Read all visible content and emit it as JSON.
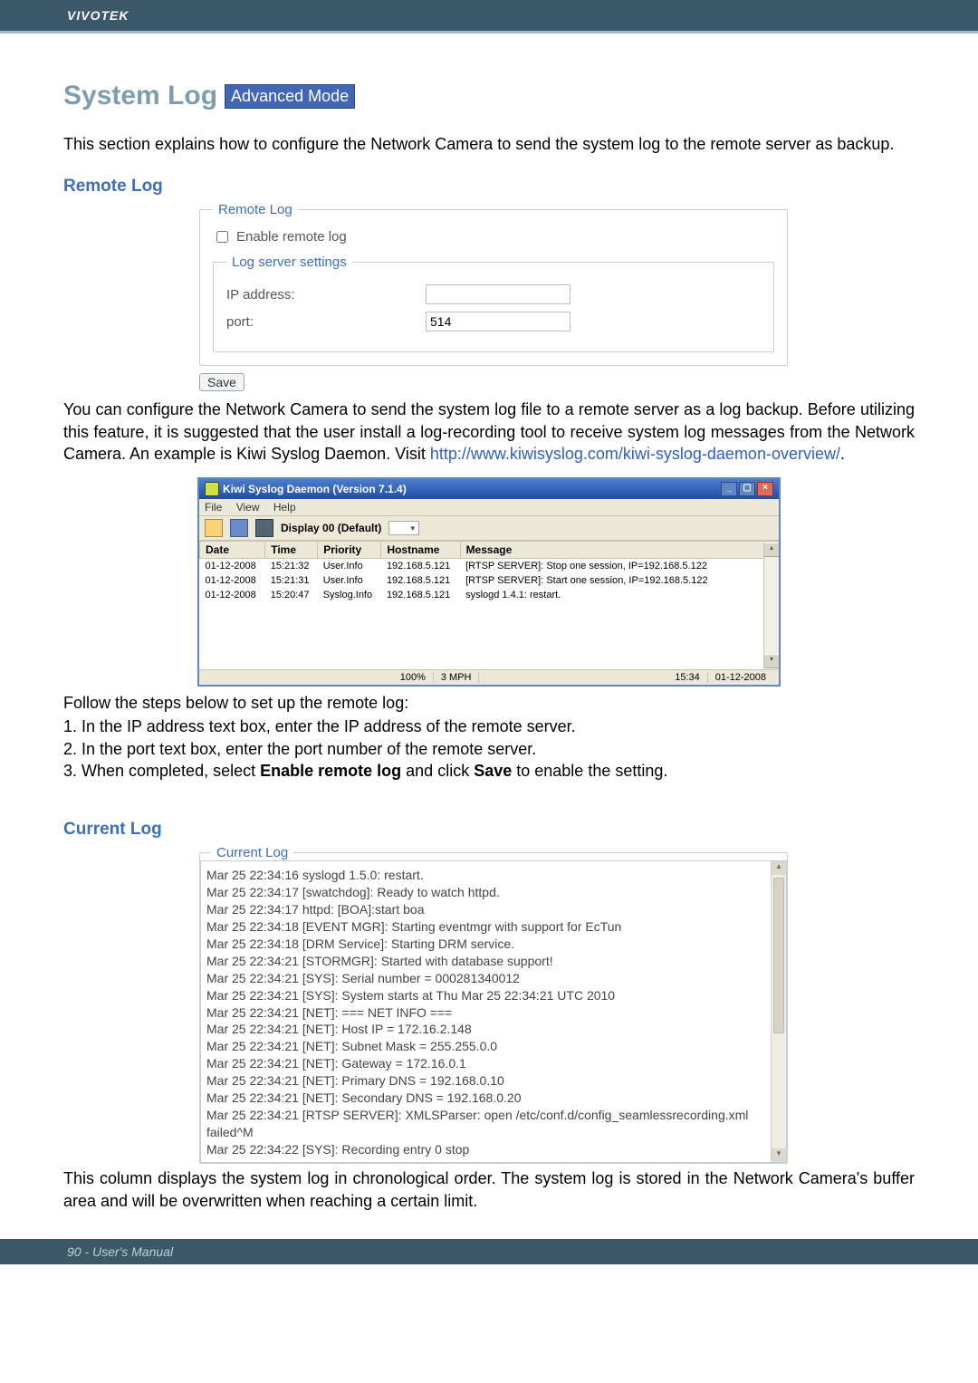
{
  "brand": "VIVOTEK",
  "page_title": "System Log",
  "adv_mode": "Advanced Mode",
  "intro": "This section explains how to configure the Network Camera to send the system log to the remote server as backup.",
  "remote_log": {
    "heading": "Remote Log",
    "legend": "Remote Log",
    "enable_label": "Enable remote log",
    "server_legend": "Log server settings",
    "ip_label": "IP address:",
    "ip_value": "",
    "port_label": "port:",
    "port_value": "514",
    "save": "Save"
  },
  "desc_before_link": "You can configure the Network Camera to send the system log file to a remote server as a log backup. Before utilizing this feature, it is suggested that the user install a log-recording tool to receive system log messages from the Network Camera. An example is Kiwi Syslog Daemon. Visit ",
  "link_text": "http://www.kiwisyslog.com/kiwi-syslog-daemon-overview/",
  "desc_after_link": ".",
  "kiwi": {
    "title": "Kiwi Syslog Daemon (Version 7.1.4)",
    "menu": [
      "File",
      "View",
      "Help"
    ],
    "display_label": "Display 00 (Default)",
    "columns": [
      "Date",
      "Time",
      "Priority",
      "Hostname",
      "Message"
    ],
    "rows": [
      {
        "date": "01-12-2008",
        "time": "15:21:32",
        "priority": "User.Info",
        "host": "192.168.5.121",
        "msg": "[RTSP SERVER]: Stop one session, IP=192.168.5.122"
      },
      {
        "date": "01-12-2008",
        "time": "15:21:31",
        "priority": "User.Info",
        "host": "192.168.5.121",
        "msg": "[RTSP SERVER]: Start one session, IP=192.168.5.122"
      },
      {
        "date": "01-12-2008",
        "time": "15:20:47",
        "priority": "Syslog.Info",
        "host": "192.168.5.121",
        "msg": "syslogd 1.4.1: restart."
      }
    ],
    "status": {
      "pct": "100%",
      "mph": "3 MPH",
      "time": "15:34",
      "date": "01-12-2008"
    }
  },
  "steps_intro": "Follow the steps below to set up the remote log:",
  "steps": [
    "1. In the IP address text box, enter the IP address of the remote server.",
    "2. In the port text box, enter the port number of the remote server.",
    "3. When completed, select Enable remote log and click Save to enable the setting."
  ],
  "current_log": {
    "heading": "Current Log",
    "legend": "Current Log",
    "lines": [
      "Mar 25 22:34:16 syslogd 1.5.0: restart.",
      "Mar 25 22:34:17 [swatchdog]: Ready to watch httpd.",
      "Mar 25 22:34:17 httpd: [BOA]:start boa",
      "Mar 25 22:34:18 [EVENT MGR]: Starting eventmgr with support for EcTun",
      "Mar 25 22:34:18 [DRM Service]: Starting DRM service.",
      "Mar 25 22:34:21 [STORMGR]: Started with database support!",
      "Mar 25 22:34:21 [SYS]: Serial number = 000281340012",
      "Mar 25 22:34:21 [SYS]: System starts at Thu Mar 25 22:34:21 UTC 2010",
      "Mar 25 22:34:21 [NET]: === NET INFO ===",
      "Mar 25 22:34:21 [NET]: Host IP = 172.16.2.148",
      "Mar 25 22:34:21 [NET]: Subnet Mask = 255.255.0.0",
      "Mar 25 22:34:21 [NET]: Gateway = 172.16.0.1",
      "Mar 25 22:34:21 [NET]: Primary DNS = 192.168.0.10",
      "Mar 25 22:34:21 [NET]: Secondary DNS = 192.168.0.20",
      "Mar 25 22:34:21 [RTSP SERVER]: XMLSParser: open /etc/conf.d/config_seamlessrecording.xml failed^M",
      "Mar 25 22:34:22 [SYS]: Recording entry 0 stop"
    ]
  },
  "current_log_desc": "This column displays the system log in chronological order. The system log is stored in the Network Camera's buffer area and will be overwritten when reaching a certain limit.",
  "footer": "90 - User's Manual"
}
